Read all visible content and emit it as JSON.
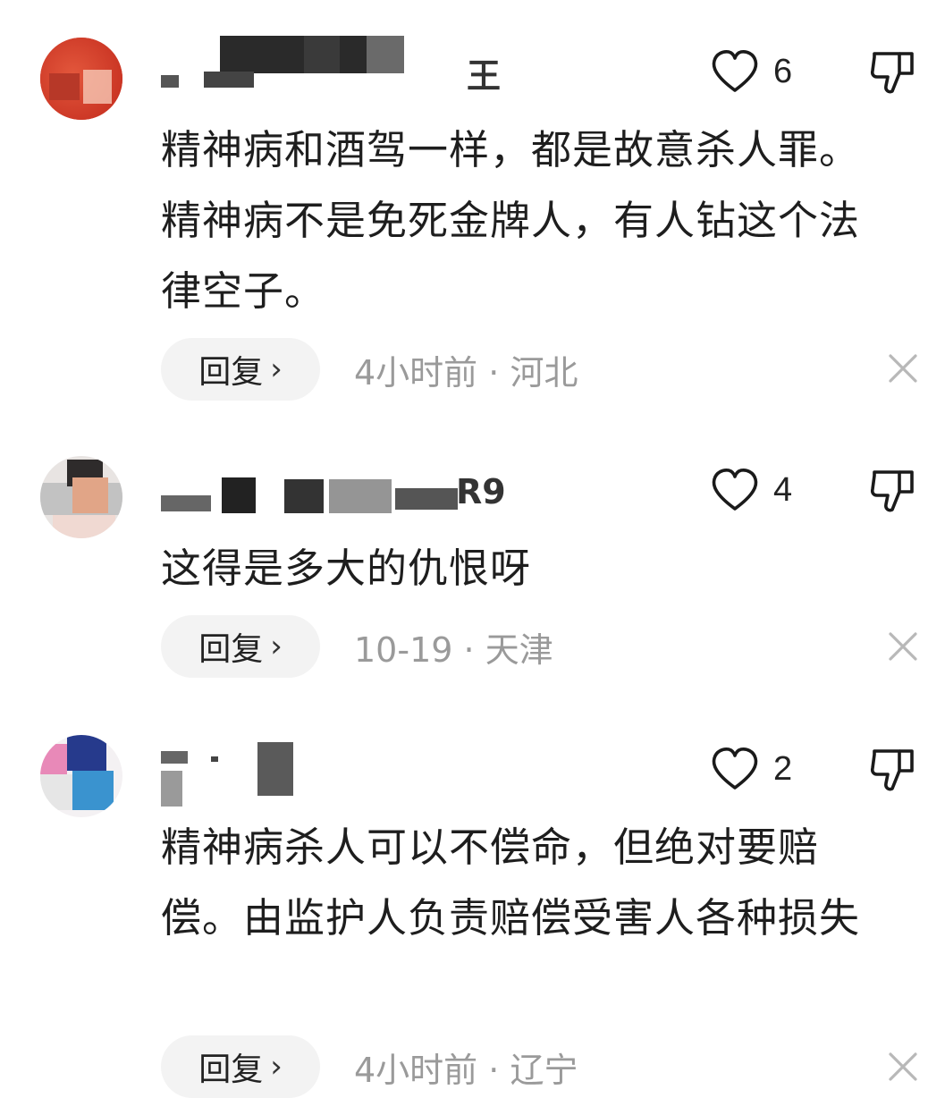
{
  "comments": [
    {
      "username_suffix": "王",
      "likes": "6",
      "text": "精神病和酒驾一样，都是故意杀人罪。精神病不是免死金牌人，有人钻这个法律空子。",
      "reply_label": "回复",
      "reply_chevron": "›",
      "time": "4小时前",
      "separator": "·",
      "location": "河北"
    },
    {
      "username_suffix": "R9",
      "likes": "4",
      "text": "这得是多大的仇恨呀",
      "reply_label": "回复",
      "reply_chevron": "›",
      "time": "10-19",
      "separator": "·",
      "location": "天津"
    },
    {
      "username_suffix": "",
      "likes": "2",
      "text": "精神病杀人可以不偿命，但绝对要赔偿。由监护人负责赔偿受害人各种损失",
      "reply_label": "回复",
      "reply_chevron": "›",
      "time": "4小时前",
      "separator": "·",
      "location": "辽宁"
    }
  ],
  "icons": {
    "like": "heart-outline-icon",
    "dislike": "thumbs-down-outline-icon",
    "close": "close-icon"
  }
}
